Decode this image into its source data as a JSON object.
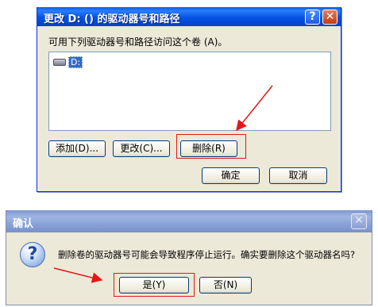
{
  "dialog1": {
    "title": "更改 D: () 的驱动器号和路径",
    "help_label": "?",
    "close_label": "✕",
    "description": "可用下列驱动器号和路径访问这个卷 (A)。",
    "list_items": [
      {
        "label": "D:"
      }
    ],
    "buttons": {
      "add": "添加(D)...",
      "change": "更改(C)...",
      "delete": "删除(R)",
      "ok": "确定",
      "cancel": "取消"
    },
    "icons": {
      "drive": "drive-icon",
      "help": "help-icon",
      "close": "close-icon"
    }
  },
  "dialog2": {
    "title": "确认",
    "close_label": "✕",
    "icon_glyph": "?",
    "message": "删除卷的驱动器号可能会导致程序停止运行。确实要删除这个驱动器名吗?",
    "buttons": {
      "yes": "是(Y)",
      "no": "否(N)"
    },
    "icons": {
      "question": "question-icon",
      "close": "close-icon"
    }
  },
  "annotation_color": "#e21818"
}
